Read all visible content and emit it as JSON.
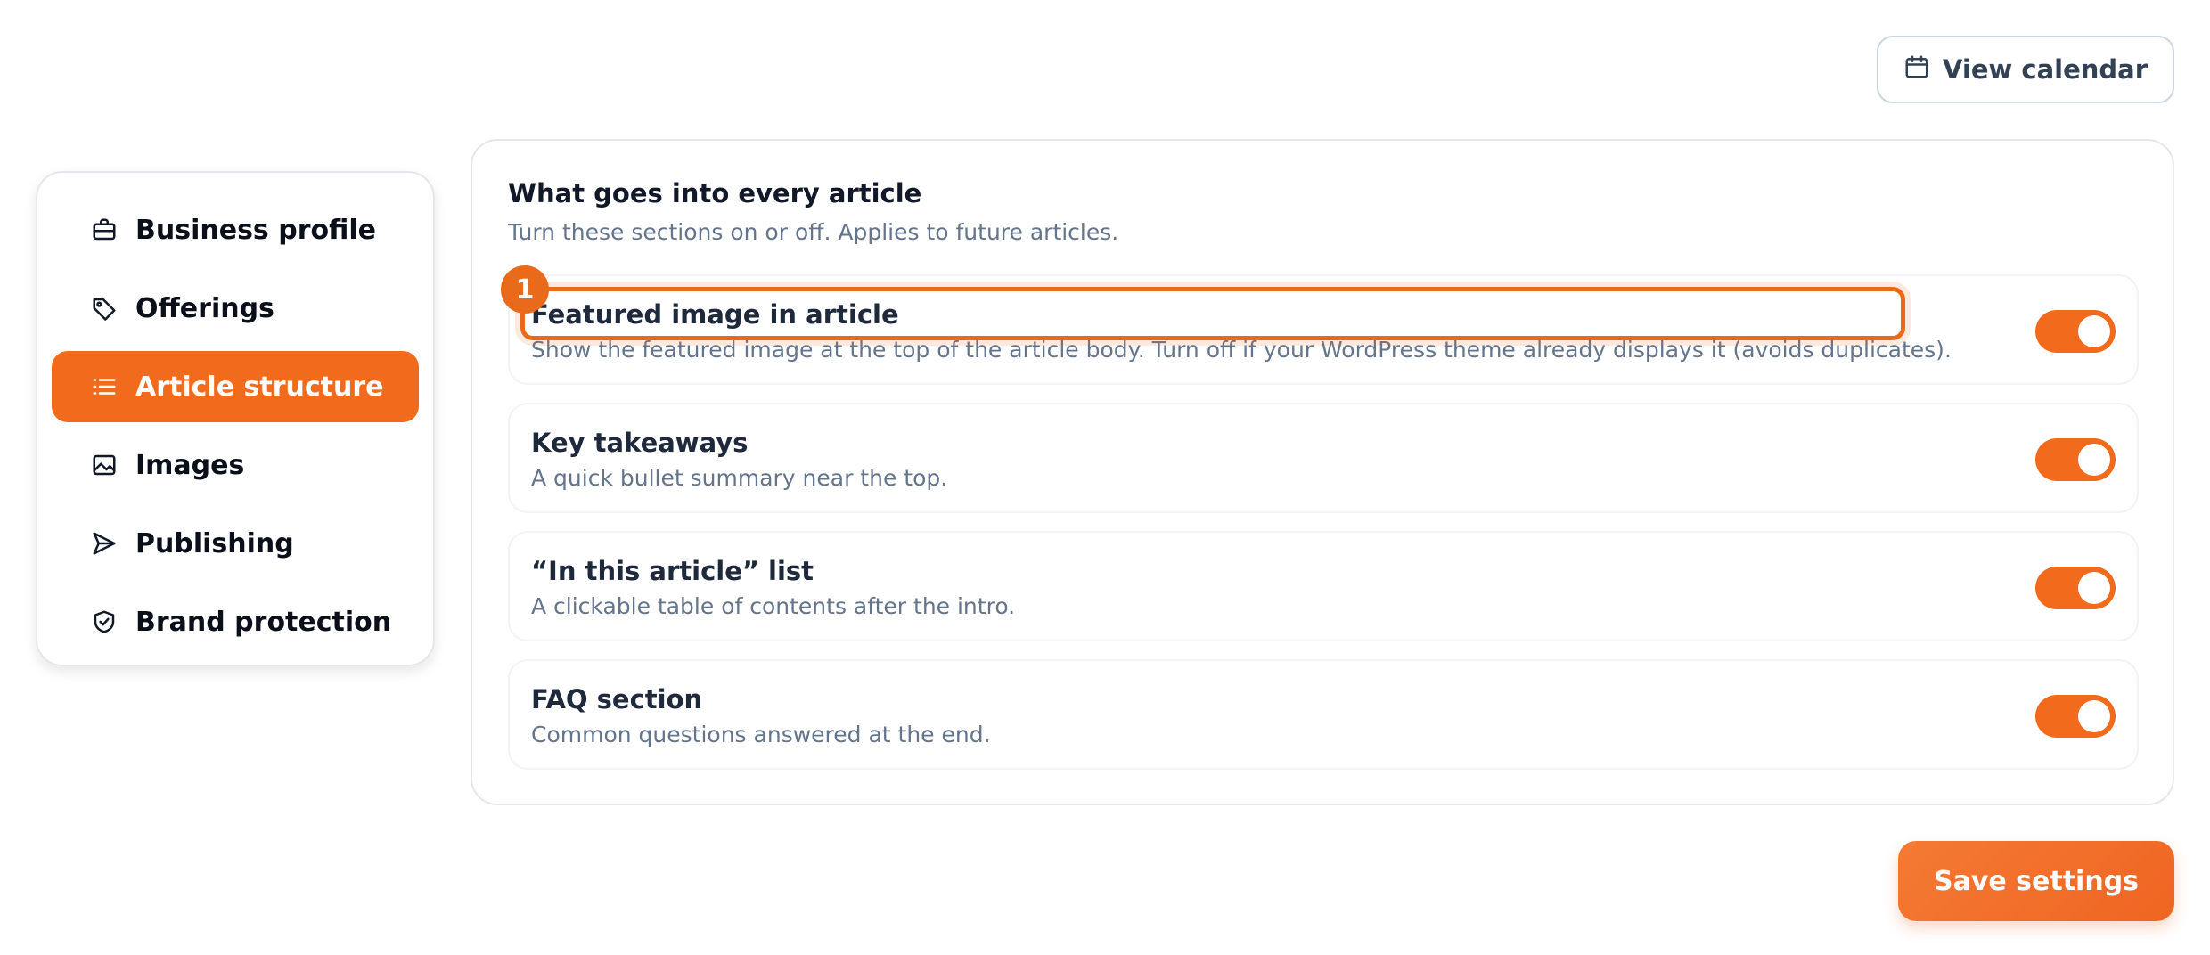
{
  "header": {
    "view_calendar_label": "View calendar",
    "view_calendar_icon": "calendar-icon"
  },
  "sidebar": {
    "items": [
      {
        "label": "Business profile",
        "icon": "briefcase-icon",
        "active": false
      },
      {
        "label": "Offerings",
        "icon": "tag-icon",
        "active": false
      },
      {
        "label": "Article structure",
        "icon": "list-icon",
        "active": true
      },
      {
        "label": "Images",
        "icon": "image-icon",
        "active": false
      },
      {
        "label": "Publishing",
        "icon": "send-icon",
        "active": false
      },
      {
        "label": "Brand protection",
        "icon": "shield-check-icon",
        "active": false
      }
    ]
  },
  "main": {
    "title": "What goes into every article",
    "subtitle": "Turn these sections on or off. Applies to future articles.",
    "sections": [
      {
        "title": "Featured image in article",
        "description": "Show the featured image at the top of the article body. Turn off if your WordPress theme already displays it (avoids duplicates).",
        "enabled": true
      },
      {
        "title": "Key takeaways",
        "description": "A quick bullet summary near the top.",
        "enabled": true
      },
      {
        "title": "“In this article” list",
        "description": "A clickable table of contents after the intro.",
        "enabled": true
      },
      {
        "title": "FAQ section",
        "description": "Common questions answered at the end.",
        "enabled": true
      }
    ]
  },
  "annotation": {
    "marker": "1"
  },
  "footer": {
    "save_label": "Save settings"
  },
  "colors": {
    "accent": "#f26b1d",
    "muted_text": "#64748b",
    "border": "#e5e7eb"
  }
}
